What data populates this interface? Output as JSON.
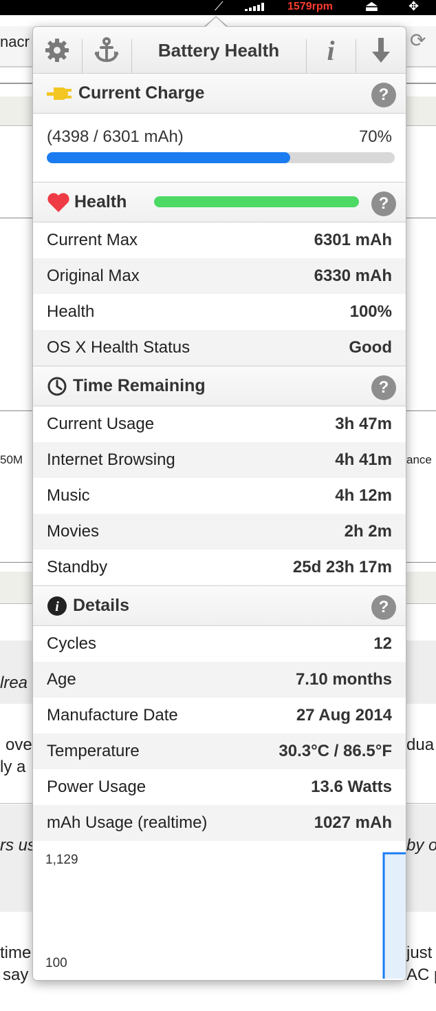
{
  "menubar": {
    "rpm": "1579rpm"
  },
  "background": {
    "snippets": [
      "nacr",
      "50M",
      "ance",
      "lrea",
      "ove",
      "dua",
      "ly a",
      "rs us",
      "by o",
      "time",
      "just",
      "say",
      "AC p"
    ]
  },
  "toolbar": {
    "title": "Battery Health",
    "settings_icon": "gear-icon",
    "anchor_icon": "anchor-icon",
    "info_label": "i",
    "download_icon": "download-arrow-icon"
  },
  "current_charge": {
    "title": "Current Charge",
    "help": "?",
    "detail": "(4398 / 6301 mAh)",
    "percent_label": "70%",
    "percent": 70,
    "bar_color": "#1a7cf0"
  },
  "health_section": {
    "title": "Health",
    "help": "?",
    "bar_level": 100,
    "bar_color": "#4cd964",
    "rows": [
      {
        "label": "Current Max",
        "value": "6301 mAh"
      },
      {
        "label": "Original Max",
        "value": "6330 mAh"
      },
      {
        "label": "Health",
        "value": "100%"
      },
      {
        "label": "OS X Health Status",
        "value": "Good"
      }
    ]
  },
  "time_remaining": {
    "title": "Time Remaining",
    "help": "?",
    "rows": [
      {
        "label": "Current Usage",
        "value": "3h 47m"
      },
      {
        "label": "Internet Browsing",
        "value": "4h 41m"
      },
      {
        "label": "Music",
        "value": "4h 12m"
      },
      {
        "label": "Movies",
        "value": "2h 2m"
      },
      {
        "label": "Standby",
        "value": "25d 23h 17m"
      }
    ]
  },
  "details": {
    "title": "Details",
    "help": "?",
    "rows": [
      {
        "label": "Cycles",
        "value": "12"
      },
      {
        "label": "Age",
        "value": "7.10 months"
      },
      {
        "label": "Manufacture Date",
        "value": "27 Aug 2014"
      },
      {
        "label": "Temperature",
        "value": "30.3°C / 86.5°F"
      },
      {
        "label": "Power Usage",
        "value": "13.6 Watts"
      },
      {
        "label": "mAh Usage (realtime)",
        "value": "1027 mAh"
      }
    ]
  },
  "usage_chart": {
    "y_max_label": "1,129",
    "y_min_label": "100",
    "line_color": "#1a7cf0"
  },
  "chart_data": {
    "type": "area",
    "ylim": [
      100,
      1129
    ],
    "tick_labels": [
      "1,129",
      "100"
    ],
    "series": [
      {
        "values": [
          100,
          1129,
          1129
        ]
      }
    ]
  }
}
